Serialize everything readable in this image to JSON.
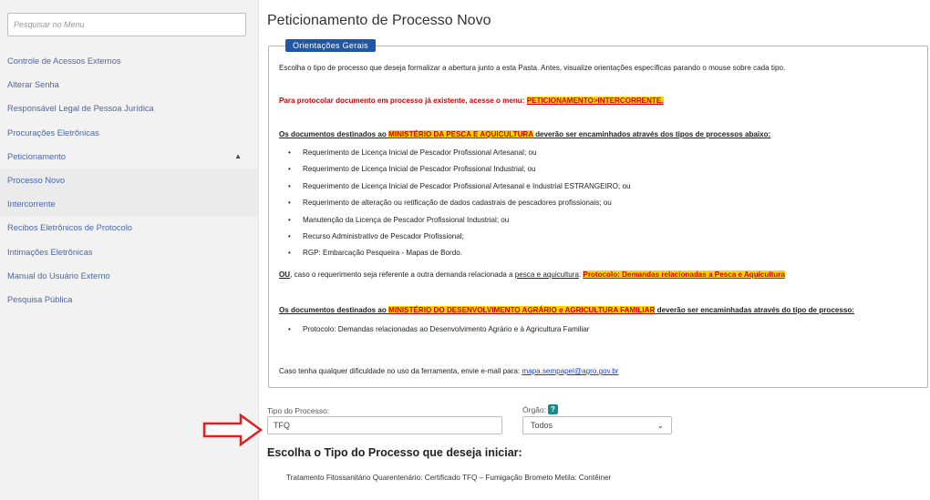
{
  "sidebar": {
    "search_placeholder": "Pesquisar no Menu",
    "items": [
      {
        "label": "Controle de Acessos Externos"
      },
      {
        "label": "Alterar Senha"
      },
      {
        "label": "Responsável Legal de Pessoa Jurídica"
      },
      {
        "label": "Procurações Eletrônicas"
      },
      {
        "label": "Peticionamento"
      },
      {
        "label": "Processo Novo"
      },
      {
        "label": "Intercorrente"
      },
      {
        "label": "Recibos Eletrônicos de Protocolo"
      },
      {
        "label": "Intimações Eletrônicas"
      },
      {
        "label": "Manual do Usuário Externo"
      },
      {
        "label": "Pesquisa Pública"
      }
    ],
    "expanded_chevron": "▲"
  },
  "main": {
    "title": "Peticionamento de Processo Novo",
    "guide": {
      "legend": "Orientações Gerais",
      "intro": "Escolha o tipo de processo que deseja formalizar a abertura junto a esta Pasta. Antes, visualize orientações específicas parando o mouse sobre cada tipo.",
      "protocol_text": "Para protocolar documento em processo já existente, acesse o menu: ",
      "protocol_menu": "PETICIONAMENTO>INTERCORRENTE.",
      "pesca_pre": "Os documentos destinados ao ",
      "pesca_org": "MINISTÉRIO DA PESCA E AQUICULTURA",
      "pesca_post": " deverão ser encaminhados através dos tipos de processos abaixo:",
      "pesca_items": [
        "Requerimento de Licença Inicial de Pescador Profissional Artesanal; ou",
        "Requerimento de Licença Inicial de Pescador Profissional Industrial; ou",
        "Requerimento de Licença Inicial de Pescador Profissional Artesanal e Industrial ESTRANGEIRO; ou",
        "Requerimento de alteração ou retificação de dados cadastrais de pescadores profissionais; ou",
        "Manutenção da Licença de Pescador Profissional Industrial; ou",
        "Recurso Administrativo de Pescador Profissional;",
        "RGP: Embarcação Pesqueira - Mapas de Bordo."
      ],
      "ou_label": "OU",
      "ou_text": ", caso o requerimento seja referente a outra demanda relacionada a ",
      "ou_topic": "pesca e aquicultura",
      "ou_colon": ": ",
      "ou_protocol": "Protocolo: Demandas relacionadas a Pesca e Aquicultura",
      "mda_pre": "Os documentos destinados ao ",
      "mda_org": "MINISTÉRIO DO DESENVOLVIMENTO AGRÁRIO e AGRICULTURA FAMILIAR",
      "mda_post": " deverão ser encaminhadas através do tipo de processo:",
      "mda_items": [
        "Protocolo: Demandas relacionadas ao Desenvolvimento Agrário e à Agricultura Familiar"
      ],
      "contact_text": "Caso tenha qualquer dificuldade no uso da ferramenta, envie e-mail para: ",
      "contact_email": "mapa.sempapel@agro.gov.br"
    },
    "form": {
      "tipo_label": "Tipo do Processo:",
      "tipo_value": "TFQ",
      "orgao_label": "Órgão:",
      "help_icon": "?",
      "orgao_value": "Todos",
      "select_chevron": "⌄"
    },
    "section_title": "Escolha o Tipo do Processo que deseja iniciar:",
    "results": [
      "Tratamento Fitossanitário Quarentenário: Certificado TFQ – Fumigação Brometo Metila: Contêiner"
    ]
  },
  "colors": {
    "accent_blue": "#1f56a6",
    "link_blue": "#4a67a8",
    "highlight_yellow": "#ffd400",
    "alert_red": "#d00000",
    "arrow_red": "#e02020",
    "help_teal": "#1a8a8a"
  }
}
